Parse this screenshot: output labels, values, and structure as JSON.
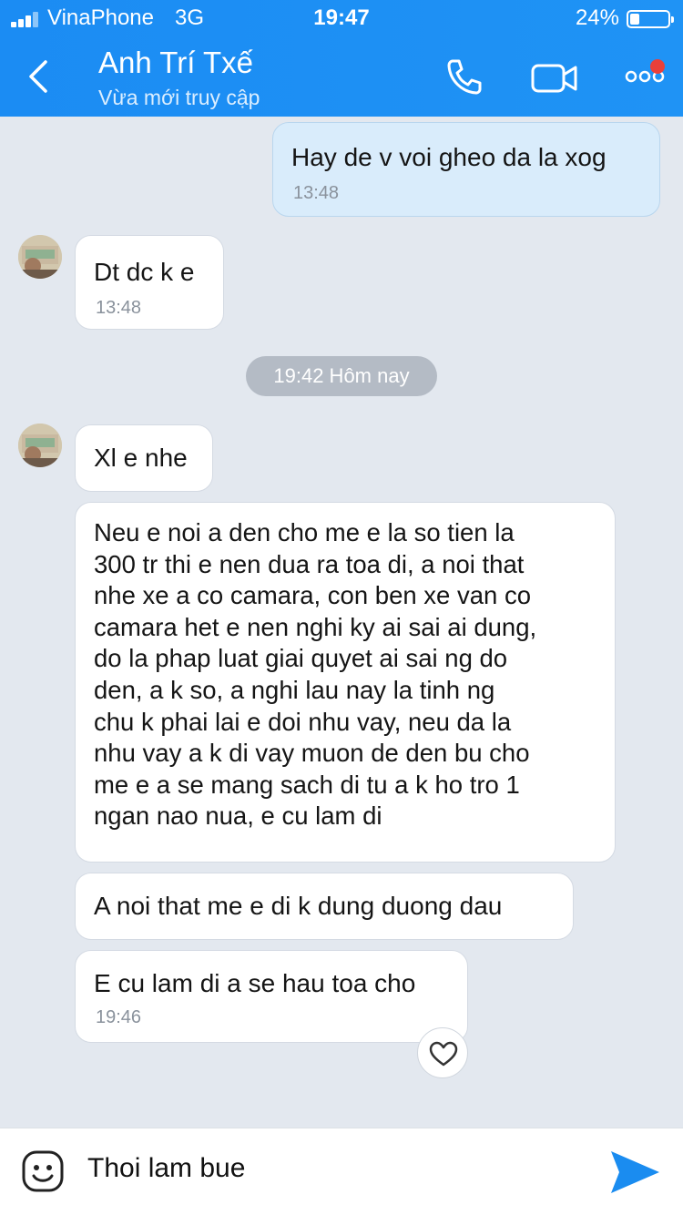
{
  "status_bar": {
    "carrier": "VinaPhone",
    "network": "3G",
    "time": "19:47",
    "battery": "24%",
    "battery_level": 0.24
  },
  "header": {
    "contact_name": "Anh Trí Txế",
    "contact_status": "Vừa mới truy cập",
    "icons": [
      "back-arrow-icon",
      "phone-icon",
      "video-camera-icon",
      "more-icon"
    ]
  },
  "messages": [
    {
      "from": "me",
      "text": "Hay de v voi gheo da la xog",
      "time": "13:48"
    },
    {
      "from": "contact",
      "text": "Dt dc k e",
      "time": "13:48"
    }
  ],
  "date_separator": "19:42 Hôm nay",
  "messages_today": [
    {
      "from": "contact",
      "text": "Xl e nhe"
    },
    {
      "from": "contact",
      "lines": [
        "Neu e noi a den cho me e la so tien la",
        "300 tr thi e nen dua ra toa di, a noi that",
        "nhe xe a co camara, con ben xe van co",
        "camara het e nen nghi ky ai sai ai dung,",
        "do la phap luat giai quyet ai sai ng do",
        "den, a k so, a nghi lau nay la tinh ng",
        "chu k phai lai e doi nhu vay, neu da la",
        "nhu vay a k di vay muon de den bu cho",
        "me e a se mang sach di tu a k ho tro 1",
        "ngan nao nua, e cu lam di"
      ]
    },
    {
      "from": "contact",
      "text": "A noi that me e di k dung duong dau"
    },
    {
      "from": "contact",
      "text": "E cu lam di a se hau toa cho",
      "time": "19:46"
    }
  ],
  "input": {
    "value": "Thoi lam bue"
  },
  "colors": {
    "header": "#1b8cf3",
    "background": "#e3e8ef",
    "mine_bubble": "#d9ecfb",
    "send": "#1a8cf0"
  }
}
